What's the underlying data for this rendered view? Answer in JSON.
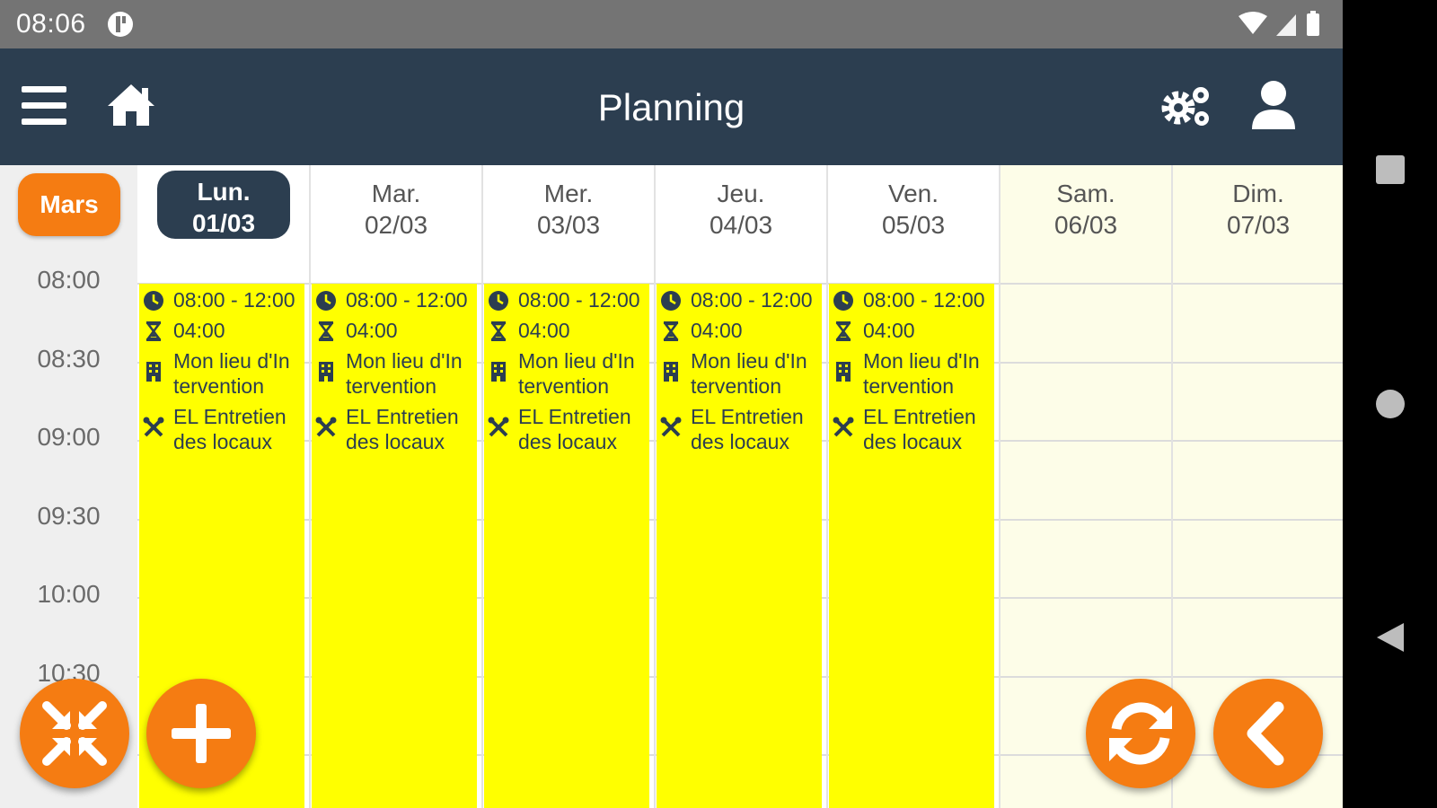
{
  "status_bar": {
    "time": "08:06"
  },
  "header": {
    "title": "Planning"
  },
  "month": "Mars",
  "days": [
    {
      "name": "Lun.",
      "date": "01/03",
      "active": true
    },
    {
      "name": "Mar.",
      "date": "02/03",
      "active": false
    },
    {
      "name": "Mer.",
      "date": "03/03",
      "active": false
    },
    {
      "name": "Jeu.",
      "date": "04/03",
      "active": false
    },
    {
      "name": "Ven.",
      "date": "05/03",
      "active": false
    },
    {
      "name": "Sam.",
      "date": "06/03",
      "active": false
    },
    {
      "name": "Dim.",
      "date": "07/03",
      "active": false
    }
  ],
  "times": [
    "08:00",
    "08:30",
    "09:00",
    "09:30",
    "10:00",
    "10:30"
  ],
  "events": [
    {
      "time": "08:00 - 12:00",
      "duration": "04:00",
      "location": "Mon lieu d'In tervention",
      "service": "EL Entretien des locaux"
    },
    {
      "time": "08:00 - 12:00",
      "duration": "04:00",
      "location": "Mon lieu d'In tervention",
      "service": "EL Entretien des locaux"
    },
    {
      "time": "08:00 - 12:00",
      "duration": "04:00",
      "location": "Mon lieu d'In tervention",
      "service": "EL Entretien des locaux"
    },
    {
      "time": "08:00 - 12:00",
      "duration": "04:00",
      "location": "Mon lieu d'In tervention",
      "service": "EL Entretien des locaux"
    },
    {
      "time": "08:00 - 12:00",
      "duration": "04:00",
      "location": "Mon lieu d'In tervention",
      "service": "EL Entretien des locaux"
    }
  ],
  "icons": {
    "menu": "menu-icon",
    "home": "home-icon",
    "settings": "gears-icon",
    "user": "user-icon",
    "collapse": "collapse-arrows-icon",
    "add": "plus-icon",
    "refresh": "refresh-icon",
    "back": "chevron-left-icon"
  },
  "colors": {
    "header": "#2c3e50",
    "accent": "#f57c12",
    "event": "#ffff00",
    "weekend": "#fdfde8"
  }
}
